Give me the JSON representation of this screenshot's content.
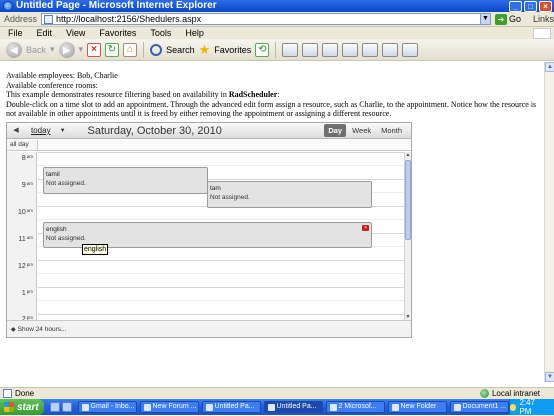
{
  "window": {
    "title": "Untitled Page - Microsoft Internet Explorer"
  },
  "address": {
    "label": "Address",
    "url": "http://localhost:2156/Shedulers.aspx",
    "go_label": "Go",
    "links_label": "Links"
  },
  "menu": {
    "items": [
      "File",
      "Edit",
      "View",
      "Favorites",
      "Tools",
      "Help"
    ]
  },
  "toolbar": {
    "back_label": "Back",
    "search_label": "Search",
    "favorites_label": "Favorites"
  },
  "page": {
    "line1": "Available employees: Bob, Charlie",
    "line2": "Available conference rooms:",
    "line3_prefix": "This example demonstrates resource filtering based on availability in ",
    "line3_bold": "RadScheduler",
    "line3_suffix": ":",
    "line4": "Double-click on a time slot to add an appointment. Through the advanced edit form assign a resource, such as Charlie, to the appointment. Notice how the resource is not available in other appointments until it is freed by either removing the appointment or assigning a different resource."
  },
  "scheduler": {
    "today_label": "today",
    "date": "Saturday, October 30, 2010",
    "views": [
      {
        "label": "Day",
        "active": true
      },
      {
        "label": "Week",
        "active": false
      },
      {
        "label": "Month",
        "active": false
      }
    ],
    "allday_label": "all day",
    "hours": [
      {
        "hour": "8",
        "suffix": "am"
      },
      {
        "hour": "9",
        "suffix": "am"
      },
      {
        "hour": "10",
        "suffix": "am"
      },
      {
        "hour": "11",
        "suffix": "am"
      },
      {
        "hour": "12",
        "suffix": "pm"
      },
      {
        "hour": "1",
        "suffix": "pm"
      },
      {
        "hour": "2",
        "suffix": "pm"
      }
    ],
    "appointments": [
      {
        "subject": "tamil",
        "resource": "Not assigned."
      },
      {
        "subject": "tam",
        "resource": "Not assigned."
      },
      {
        "subject": "english",
        "resource": "Not assigned.",
        "selected": true
      }
    ],
    "tooltip": "english",
    "footer_label": "Show 24 hours..."
  },
  "status": {
    "text": "Done",
    "zone": "Local intranet"
  },
  "taskbar": {
    "start_label": "start",
    "items": [
      {
        "label": "Gmail - Inbo...",
        "active": false
      },
      {
        "label": "New Forum ...",
        "active": false
      },
      {
        "label": "Untitled Pa...",
        "active": false
      },
      {
        "label": "Untitled Pa...",
        "active": true
      },
      {
        "label": "2 Microsof...",
        "active": false
      },
      {
        "label": "New Folder",
        "active": false
      },
      {
        "label": "Document1 ...",
        "active": false
      }
    ],
    "clock": "2:47 PM"
  }
}
